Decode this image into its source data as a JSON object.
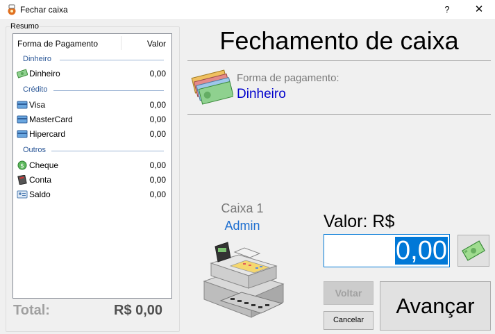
{
  "window": {
    "title": "Fechar caixa",
    "help_label": "?",
    "close_label": "✕"
  },
  "resumo": {
    "legend": "Resumo",
    "headers": {
      "forma": "Forma de Pagamento",
      "valor": "Valor"
    },
    "groups": [
      {
        "label": "Dinheiro",
        "items": [
          {
            "label": "Dinheiro",
            "value": "0,00",
            "icon": "banknote-icon"
          }
        ]
      },
      {
        "label": "Crédito",
        "items": [
          {
            "label": "Visa",
            "value": "0,00",
            "icon": "card-icon"
          },
          {
            "label": "MasterCard",
            "value": "0,00",
            "icon": "card-icon"
          },
          {
            "label": "Hipercard",
            "value": "0,00",
            "icon": "card-icon"
          }
        ]
      },
      {
        "label": "Outros",
        "items": [
          {
            "label": "Cheque",
            "value": "0,00",
            "icon": "coin-icon"
          },
          {
            "label": "Conta",
            "value": "0,00",
            "icon": "account-book-icon"
          },
          {
            "label": "Saldo",
            "value": "0,00",
            "icon": "id-card-icon"
          }
        ]
      }
    ],
    "total_label": "Total:",
    "total_value": "R$ 0,00"
  },
  "main": {
    "title": "Fechamento de caixa",
    "payment_label": "Forma de pagamento:",
    "payment_value": "Dinheiro",
    "caixa_name": "Caixa 1",
    "caixa_user": "Admin",
    "valor_label": "Valor: R$",
    "valor_input": "0,00"
  },
  "buttons": {
    "voltar": "Voltar",
    "cancelar": "Cancelar",
    "avancar": "Avançar"
  },
  "colors": {
    "accent": "#0078d7",
    "payment_value": "#0000cc",
    "user": "#1e6fd0",
    "group_header": "#2b5797"
  }
}
